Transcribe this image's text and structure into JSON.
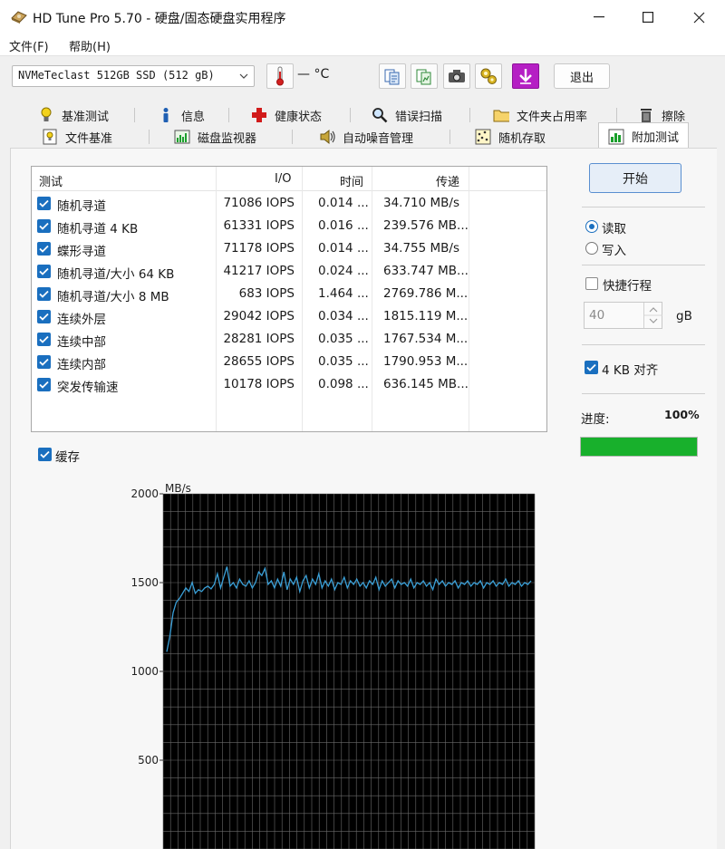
{
  "window": {
    "title": "HD Tune Pro 5.70 - 硬盘/固态硬盘实用程序"
  },
  "menu": {
    "file": "文件(F)",
    "help": "帮助(H)"
  },
  "toolbar": {
    "drive": "NVMeTeclast 512GB SSD (512 gB)",
    "temperature": "— °C",
    "exit_label": "退出",
    "icons": [
      "copy-text-icon",
      "copy-image-icon",
      "camera-icon",
      "options-icon",
      "save-icon"
    ]
  },
  "tabs_row1": [
    {
      "label": "基准测试",
      "icon": "bulb-icon"
    },
    {
      "label": "信息",
      "icon": "info-icon"
    },
    {
      "label": "健康状态",
      "icon": "health-cross-icon"
    },
    {
      "label": "错误扫描",
      "icon": "magnifier-icon"
    },
    {
      "label": "文件夹占用率",
      "icon": "folder-icon"
    },
    {
      "label": "擦除",
      "icon": "trash-icon"
    }
  ],
  "tabs_row2": [
    {
      "label": "文件基准",
      "icon": "file-benchmark-icon"
    },
    {
      "label": "磁盘监视器",
      "icon": "disk-monitor-icon"
    },
    {
      "label": "自动噪音管理",
      "icon": "speaker-icon"
    },
    {
      "label": "随机存取",
      "icon": "random-access-icon"
    },
    {
      "label": "附加测试",
      "icon": "extra-tests-icon",
      "active": true
    }
  ],
  "table": {
    "headers": {
      "test": "测试",
      "io": "I/O",
      "time": "时间",
      "speed": "传递"
    },
    "rows": [
      {
        "name": "随机寻道",
        "io": "71086 IOPS",
        "time": "0.014 ...",
        "speed": "34.710 MB/s"
      },
      {
        "name": "随机寻道 4 KB",
        "io": "61331 IOPS",
        "time": "0.016 ...",
        "speed": "239.576 MB..."
      },
      {
        "name": "蝶形寻道",
        "io": "71178 IOPS",
        "time": "0.014 ...",
        "speed": "34.755 MB/s"
      },
      {
        "name": "随机寻道/大小 64 KB",
        "io": "41217 IOPS",
        "time": "0.024 ...",
        "speed": "633.747 MB..."
      },
      {
        "name": "随机寻道/大小 8 MB",
        "io": "683 IOPS",
        "time": "1.464 ...",
        "speed": "2769.786 M..."
      },
      {
        "name": "连续外层",
        "io": "29042 IOPS",
        "time": "0.034 ...",
        "speed": "1815.119 M..."
      },
      {
        "name": "连续中部",
        "io": "28281 IOPS",
        "time": "0.035 ...",
        "speed": "1767.534 M..."
      },
      {
        "name": "连续内部",
        "io": "28655 IOPS",
        "time": "0.035 ...",
        "speed": "1790.953 M..."
      },
      {
        "name": "突发传输速",
        "io": "10178 IOPS",
        "time": "0.098 ...",
        "speed": "636.145 MB..."
      }
    ]
  },
  "controls": {
    "start_label": "开始",
    "read_label": "读取",
    "write_label": "写入",
    "short_stroke_label": "快捷行程",
    "short_stroke_value": "40",
    "short_stroke_unit": "gB",
    "align_label": "4 KB 对齐",
    "progress_label": "进度:",
    "progress_text": "100%",
    "progress_value": 1.0,
    "cache_label": "缓存"
  },
  "colors": {
    "accent": "#1a6fbf",
    "progress": "#18b02c",
    "chart_bg": "#000000",
    "chart_grid": "#6b6b6b",
    "chart_line": "#3aa0d8"
  },
  "chart_data": {
    "type": "line",
    "ylabel": "MB/s",
    "ylim": [
      0,
      2000
    ],
    "yticks": [
      2000,
      1500,
      1000,
      500
    ],
    "grid": true,
    "series": [
      {
        "values": [
          1110,
          1200,
          1330,
          1390,
          1410,
          1440,
          1470,
          1450,
          1500,
          1440,
          1460,
          1450,
          1470,
          1480,
          1465,
          1490,
          1550,
          1470,
          1530,
          1590,
          1480,
          1500,
          1470,
          1520,
          1490,
          1480,
          1510,
          1470,
          1500,
          1560,
          1540,
          1580,
          1490,
          1510,
          1470,
          1520,
          1480,
          1560,
          1460,
          1520,
          1490,
          1530,
          1450,
          1510,
          1540,
          1470,
          1520,
          1490,
          1550,
          1470,
          1510,
          1480,
          1520,
          1460,
          1500,
          1490,
          1530,
          1470,
          1510,
          1490,
          1520,
          1480,
          1500,
          1470,
          1510,
          1490,
          1530,
          1460,
          1510,
          1480,
          1500,
          1520,
          1470,
          1510,
          1490,
          1500,
          1480,
          1520,
          1470,
          1500,
          1490,
          1510,
          1480,
          1500,
          1460,
          1520,
          1490,
          1510,
          1480,
          1500,
          1490,
          1510,
          1470,
          1500,
          1490,
          1510,
          1480,
          1500,
          1490,
          1510,
          1470,
          1500,
          1490,
          1510,
          1480,
          1500,
          1490,
          1520,
          1480,
          1500,
          1490,
          1510,
          1480,
          1500,
          1490,
          1510
        ]
      }
    ]
  }
}
